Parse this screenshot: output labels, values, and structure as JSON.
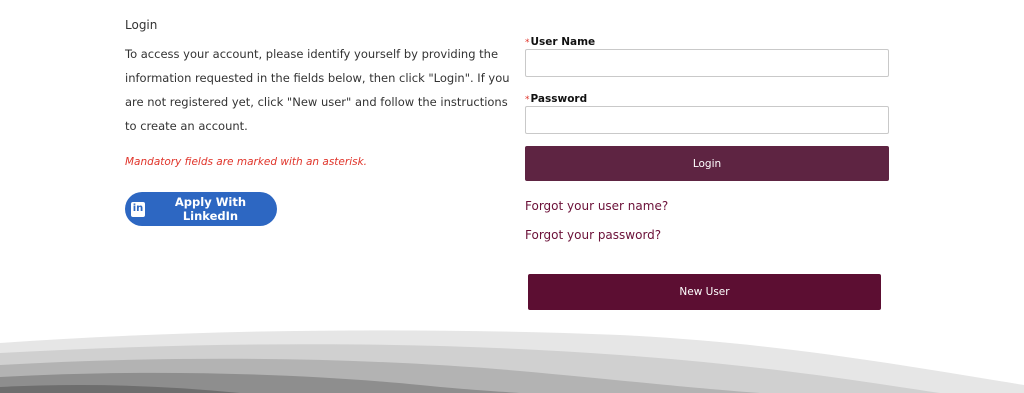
{
  "intro": {
    "heading": "Login",
    "text": "To access your account, please identify yourself by providing the information requested in the fields below, then click \"Login\". If you are not registered yet, click \"New user\" and follow the instructions to create an account.",
    "mandatory_note": "Mandatory fields are marked with an asterisk."
  },
  "linkedin": {
    "label": "Apply With LinkedIn",
    "icon_text": "in",
    "icon": "linkedin-icon",
    "color": "#2d67c2"
  },
  "form": {
    "asterisk": "*",
    "username_label": "User Name",
    "username_value": "",
    "username_placeholder": "",
    "password_label": "Password",
    "password_value": "",
    "password_placeholder": "",
    "login_label": "Login",
    "forgot_username": "Forgot your user name?",
    "forgot_password": "Forgot your password?",
    "new_user_label": "New User"
  },
  "colors": {
    "accent": "#5e2442",
    "new_user_bg": "#5c0e32",
    "link": "#6b1038",
    "required": "#e0342a"
  }
}
